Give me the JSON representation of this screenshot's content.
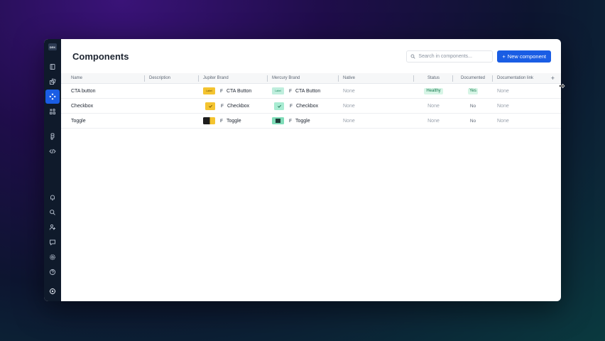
{
  "sidebar": {
    "logo": "DEK",
    "items": [
      {
        "icon": "book-icon"
      },
      {
        "icon": "shapes-icon"
      },
      {
        "icon": "components-icon",
        "active": true
      },
      {
        "icon": "tokens-icon"
      },
      {
        "icon": "figma-icon"
      },
      {
        "icon": "code-icon"
      },
      {
        "icon": "bell-icon"
      },
      {
        "icon": "search-icon"
      },
      {
        "icon": "user-add-icon"
      },
      {
        "icon": "chat-icon"
      },
      {
        "icon": "gear-icon"
      },
      {
        "icon": "help-icon"
      }
    ],
    "bottom_icon": "workspace-icon"
  },
  "header": {
    "title": "Components",
    "search_placeholder": "Search in components...",
    "new_button": "New component",
    "new_button_icon": "+"
  },
  "table": {
    "columns": [
      "Name",
      "Description",
      "Jupiter Brand",
      "Mercury Brand",
      "Native",
      "Status",
      "Documented",
      "Documentation link"
    ],
    "add_column": "+",
    "rows": [
      {
        "name": "CTA button",
        "description": "",
        "jupiter_thumb": "Label",
        "jupiter": "CTA Button",
        "mercury_thumb": "Label",
        "mercury": "CTA Button",
        "native": "None",
        "status": "Healthy",
        "documented": "Yes",
        "doc_link": "None"
      },
      {
        "name": "Checkbox",
        "description": "",
        "jupiter": "Checkbox",
        "mercury": "Checkbox",
        "native": "None",
        "status": "None",
        "documented": "No",
        "doc_link": "None"
      },
      {
        "name": "Toggle",
        "description": "",
        "jupiter": "Toggle",
        "mercury": "Toggle",
        "native": "None",
        "status": "None",
        "documented": "No",
        "doc_link": "None"
      }
    ]
  },
  "colors": {
    "accent": "#1a5de4",
    "sidebar_bg": "#0f1a2b",
    "jupiter_yellow": "#f4c430",
    "mercury_green": "#a8ecd2",
    "healthy_bg": "#d7f5e6"
  }
}
